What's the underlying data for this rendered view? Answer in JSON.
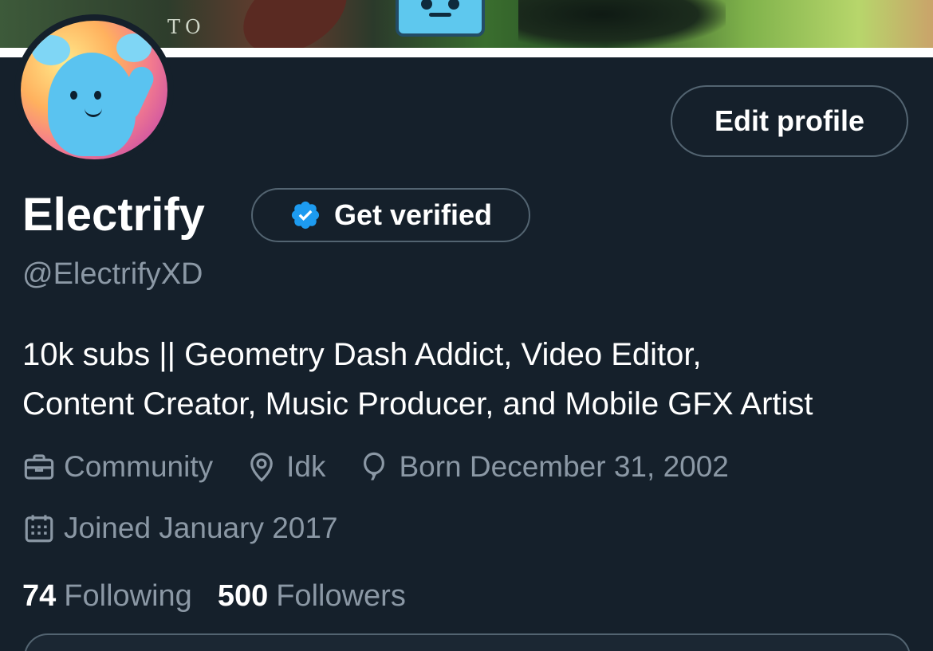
{
  "banner": {
    "watermark": "TO"
  },
  "profile": {
    "display_name": "Electrify",
    "handle": "@ElectrifyXD",
    "bio_line1": "10k subs || Geometry Dash Addict, Video Editor,",
    "bio_line2": "Content Creator, Music Producer, and Mobile GFX Artist",
    "category": "Community",
    "location": "Idk",
    "birth": "Born December 31, 2002",
    "joined": "Joined January 2017"
  },
  "actions": {
    "edit_profile_label": "Edit profile",
    "get_verified_label": "Get verified"
  },
  "stats": {
    "following_count": "74",
    "following_label": "Following",
    "followers_count": "500",
    "followers_label": "Followers"
  },
  "icons": {
    "category": "briefcase-icon",
    "location": "location-pin-icon",
    "birth": "balloon-icon",
    "joined": "calendar-icon",
    "verified": "verified-badge-icon"
  },
  "colors": {
    "background": "#15202b",
    "text_primary": "#ffffff",
    "text_secondary": "#8b98a5",
    "border": "#536471",
    "verified_blue": "#1d9bf0"
  }
}
